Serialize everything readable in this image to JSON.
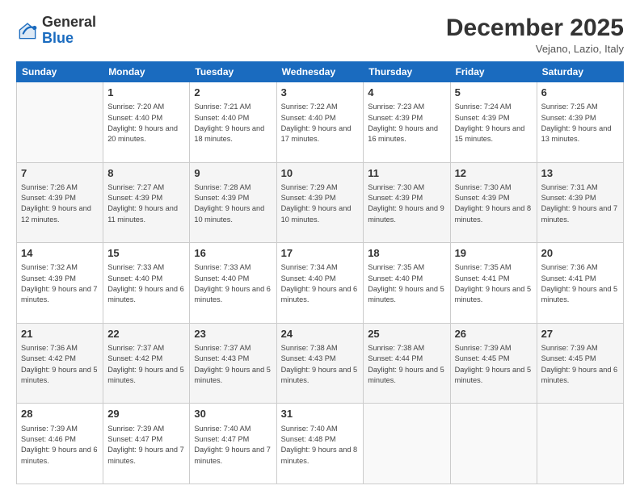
{
  "logo": {
    "general": "General",
    "blue": "Blue"
  },
  "header": {
    "month": "December 2025",
    "location": "Vejano, Lazio, Italy"
  },
  "days_of_week": [
    "Sunday",
    "Monday",
    "Tuesday",
    "Wednesday",
    "Thursday",
    "Friday",
    "Saturday"
  ],
  "weeks": [
    [
      {
        "day": null
      },
      {
        "day": 1,
        "sunrise": "7:20 AM",
        "sunset": "4:40 PM",
        "daylight": "9 hours and 20 minutes."
      },
      {
        "day": 2,
        "sunrise": "7:21 AM",
        "sunset": "4:40 PM",
        "daylight": "9 hours and 18 minutes."
      },
      {
        "day": 3,
        "sunrise": "7:22 AM",
        "sunset": "4:40 PM",
        "daylight": "9 hours and 17 minutes."
      },
      {
        "day": 4,
        "sunrise": "7:23 AM",
        "sunset": "4:39 PM",
        "daylight": "9 hours and 16 minutes."
      },
      {
        "day": 5,
        "sunrise": "7:24 AM",
        "sunset": "4:39 PM",
        "daylight": "9 hours and 15 minutes."
      },
      {
        "day": 6,
        "sunrise": "7:25 AM",
        "sunset": "4:39 PM",
        "daylight": "9 hours and 13 minutes."
      }
    ],
    [
      {
        "day": 7,
        "sunrise": "7:26 AM",
        "sunset": "4:39 PM",
        "daylight": "9 hours and 12 minutes."
      },
      {
        "day": 8,
        "sunrise": "7:27 AM",
        "sunset": "4:39 PM",
        "daylight": "9 hours and 11 minutes."
      },
      {
        "day": 9,
        "sunrise": "7:28 AM",
        "sunset": "4:39 PM",
        "daylight": "9 hours and 10 minutes."
      },
      {
        "day": 10,
        "sunrise": "7:29 AM",
        "sunset": "4:39 PM",
        "daylight": "9 hours and 10 minutes."
      },
      {
        "day": 11,
        "sunrise": "7:30 AM",
        "sunset": "4:39 PM",
        "daylight": "9 hours and 9 minutes."
      },
      {
        "day": 12,
        "sunrise": "7:30 AM",
        "sunset": "4:39 PM",
        "daylight": "9 hours and 8 minutes."
      },
      {
        "day": 13,
        "sunrise": "7:31 AM",
        "sunset": "4:39 PM",
        "daylight": "9 hours and 7 minutes."
      }
    ],
    [
      {
        "day": 14,
        "sunrise": "7:32 AM",
        "sunset": "4:39 PM",
        "daylight": "9 hours and 7 minutes."
      },
      {
        "day": 15,
        "sunrise": "7:33 AM",
        "sunset": "4:40 PM",
        "daylight": "9 hours and 6 minutes."
      },
      {
        "day": 16,
        "sunrise": "7:33 AM",
        "sunset": "4:40 PM",
        "daylight": "9 hours and 6 minutes."
      },
      {
        "day": 17,
        "sunrise": "7:34 AM",
        "sunset": "4:40 PM",
        "daylight": "9 hours and 6 minutes."
      },
      {
        "day": 18,
        "sunrise": "7:35 AM",
        "sunset": "4:40 PM",
        "daylight": "9 hours and 5 minutes."
      },
      {
        "day": 19,
        "sunrise": "7:35 AM",
        "sunset": "4:41 PM",
        "daylight": "9 hours and 5 minutes."
      },
      {
        "day": 20,
        "sunrise": "7:36 AM",
        "sunset": "4:41 PM",
        "daylight": "9 hours and 5 minutes."
      }
    ],
    [
      {
        "day": 21,
        "sunrise": "7:36 AM",
        "sunset": "4:42 PM",
        "daylight": "9 hours and 5 minutes."
      },
      {
        "day": 22,
        "sunrise": "7:37 AM",
        "sunset": "4:42 PM",
        "daylight": "9 hours and 5 minutes."
      },
      {
        "day": 23,
        "sunrise": "7:37 AM",
        "sunset": "4:43 PM",
        "daylight": "9 hours and 5 minutes."
      },
      {
        "day": 24,
        "sunrise": "7:38 AM",
        "sunset": "4:43 PM",
        "daylight": "9 hours and 5 minutes."
      },
      {
        "day": 25,
        "sunrise": "7:38 AM",
        "sunset": "4:44 PM",
        "daylight": "9 hours and 5 minutes."
      },
      {
        "day": 26,
        "sunrise": "7:39 AM",
        "sunset": "4:45 PM",
        "daylight": "9 hours and 5 minutes."
      },
      {
        "day": 27,
        "sunrise": "7:39 AM",
        "sunset": "4:45 PM",
        "daylight": "9 hours and 6 minutes."
      }
    ],
    [
      {
        "day": 28,
        "sunrise": "7:39 AM",
        "sunset": "4:46 PM",
        "daylight": "9 hours and 6 minutes."
      },
      {
        "day": 29,
        "sunrise": "7:39 AM",
        "sunset": "4:47 PM",
        "daylight": "9 hours and 7 minutes."
      },
      {
        "day": 30,
        "sunrise": "7:40 AM",
        "sunset": "4:47 PM",
        "daylight": "9 hours and 7 minutes."
      },
      {
        "day": 31,
        "sunrise": "7:40 AM",
        "sunset": "4:48 PM",
        "daylight": "9 hours and 8 minutes."
      },
      {
        "day": null
      },
      {
        "day": null
      },
      {
        "day": null
      }
    ]
  ],
  "labels": {
    "sunrise": "Sunrise:",
    "sunset": "Sunset:",
    "daylight": "Daylight:"
  }
}
